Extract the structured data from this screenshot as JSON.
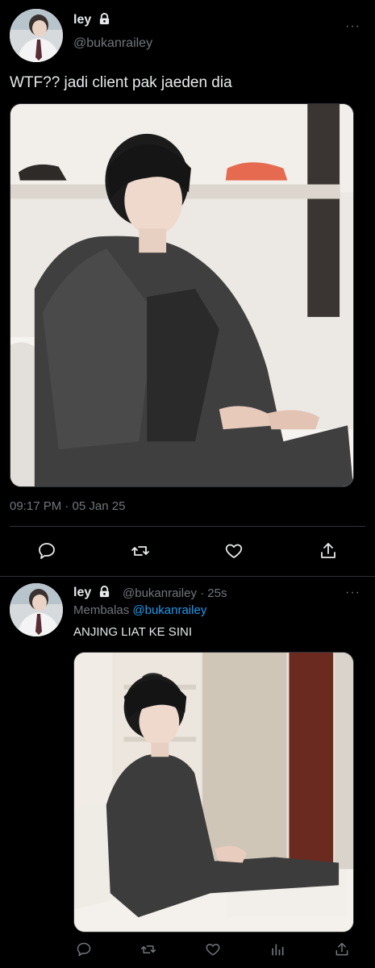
{
  "tweet": {
    "display_name": "ley",
    "handle": "@bukanrailey",
    "text": "WTF?? jadi client pak jaeden dia",
    "timestamp": "09:17 PM · 05 Jan 25",
    "more": "···"
  },
  "reply": {
    "display_name": "ley",
    "handle_time": "@bukanrailey · 25s",
    "replying_label": "Membalas",
    "replying_to": "@bukanrailey",
    "text": "ANJING LIAT KE SINI",
    "more": "···"
  },
  "icons": {
    "lock": "lock-icon",
    "reply": "reply-icon",
    "retweet": "retweet-icon",
    "like": "heart-icon",
    "share": "share-icon",
    "views": "views-icon"
  },
  "colors": {
    "background": "#000000",
    "text": "#e7e9ea",
    "muted": "#71767b",
    "link": "#1d9bf0",
    "divider": "#2f3336"
  }
}
